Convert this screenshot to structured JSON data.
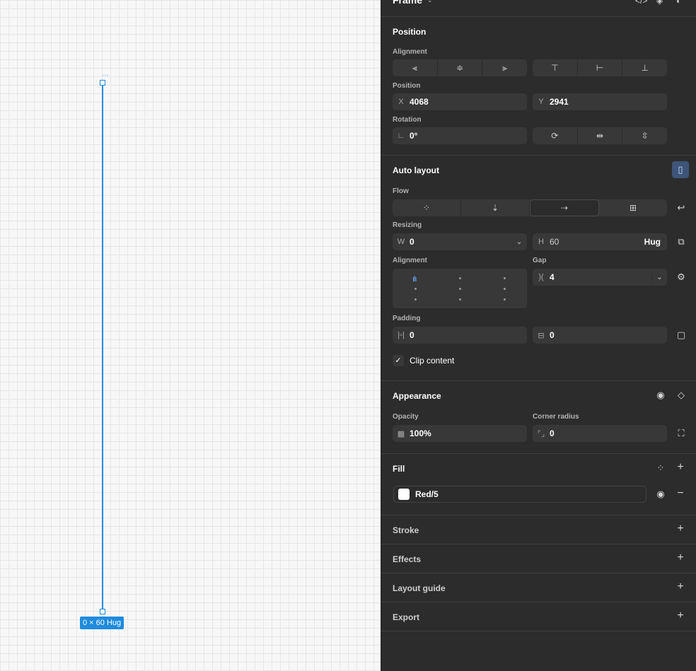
{
  "canvas": {
    "frame_name": "...",
    "size_badge": "0 × 60 Hug"
  },
  "header": {
    "title": "Frame"
  },
  "position": {
    "title": "Position",
    "alignment_label": "Alignment",
    "position_label": "Position",
    "x_label": "X",
    "x_value": "4068",
    "y_label": "Y",
    "y_value": "2941",
    "rotation_label": "Rotation",
    "rotation_value": "0°"
  },
  "auto_layout": {
    "title": "Auto layout",
    "flow_label": "Flow",
    "resizing_label": "Resizing",
    "w_label": "W",
    "w_value": "0",
    "h_label": "H",
    "h_value": "60",
    "h_mode": "Hug",
    "alignment_label": "Alignment",
    "gap_label": "Gap",
    "gap_value": "4",
    "padding_label": "Padding",
    "padding_h": "0",
    "padding_v": "0",
    "clip_content_label": "Clip content"
  },
  "appearance": {
    "title": "Appearance",
    "opacity_label": "Opacity",
    "opacity_value": "100%",
    "corner_radius_label": "Corner radius",
    "corner_radius_value": "0"
  },
  "fill": {
    "title": "Fill",
    "items": [
      {
        "name": "Red/5",
        "color": "#ffffff"
      }
    ]
  },
  "stroke": {
    "title": "Stroke"
  },
  "effects": {
    "title": "Effects"
  },
  "layout_guide": {
    "title": "Layout guide"
  },
  "export": {
    "title": "Export"
  },
  "colors": {
    "accent": "#1e8bdf",
    "panel_bg": "#2c2c2c",
    "field_bg": "#383838"
  }
}
